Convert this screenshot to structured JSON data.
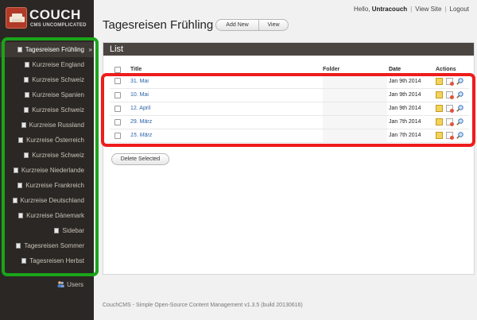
{
  "logo": {
    "title": "COUCH",
    "subtitle": "CMS UNCOMPLICATED"
  },
  "topbar": {
    "greeting": "Hello, ",
    "user": "Untracouch",
    "view_site": "View Site",
    "logout": "Logout"
  },
  "header": {
    "title": "Tagesreisen Frühling",
    "add_new": "Add New",
    "view": "View"
  },
  "sidebar": {
    "items": [
      {
        "label": "Tagesreisen Frühling",
        "active": true
      },
      {
        "label": "Kurzreise England"
      },
      {
        "label": "Kurzreise Schweiz"
      },
      {
        "label": "Kurzreise Spanien"
      },
      {
        "label": "Kurzreise Schweiz"
      },
      {
        "label": "Kurzreise Russland"
      },
      {
        "label": "Kurzreise Österreich"
      },
      {
        "label": "Kurzreise Schweiz"
      },
      {
        "label": "Kurzreise Niederlande"
      },
      {
        "label": "Kurzreise Frankreich"
      },
      {
        "label": "Kurzreise Deutschland"
      },
      {
        "label": "Kurzreise Dänemark"
      },
      {
        "label": "Sidebar"
      },
      {
        "label": "Tagesreisen Sommer"
      },
      {
        "label": "Tagesreisen Herbst"
      }
    ],
    "users": "Users"
  },
  "list": {
    "heading": "List",
    "columns": {
      "title": "Title",
      "folder": "Folder",
      "date": "Date",
      "actions": "Actions"
    },
    "rows": [
      {
        "title": "31. Mai",
        "folder": "",
        "date": "Jan 9th 2014"
      },
      {
        "title": "10. Mai",
        "folder": "",
        "date": "Jan 9th 2014"
      },
      {
        "title": "12. April",
        "folder": "",
        "date": "Jan 9th 2014"
      },
      {
        "title": "29. März",
        "folder": "",
        "date": "Jan 7th 2014"
      },
      {
        "title": "15. März",
        "folder": "",
        "date": "Jan 7th 2014",
        "italic": true
      }
    ],
    "delete_selected": "Delete Selected"
  },
  "footer": "CouchCMS - Simple Open-Source Content Management v1.3.5 (build 20130616)",
  "colors": {
    "sidebar_bg": "#2b2724",
    "accent_red": "#b23a28",
    "link": "#2a63a8",
    "highlight_green": "#1aa51a",
    "highlight_red": "#ee1c1c"
  }
}
